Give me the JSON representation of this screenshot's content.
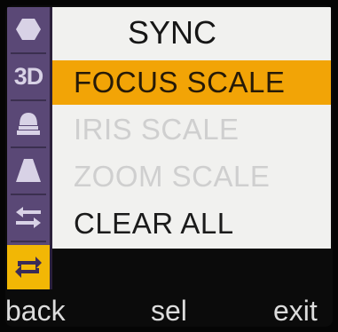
{
  "menu": {
    "title": "SYNC",
    "items": [
      {
        "label": "FOCUS SCALE",
        "state": "selected"
      },
      {
        "label": "IRIS SCALE",
        "state": "disabled"
      },
      {
        "label": "ZOOM SCALE",
        "state": "disabled"
      },
      {
        "label": "CLEAR ALL",
        "state": "normal"
      }
    ]
  },
  "rail": {
    "items": [
      {
        "icon": "hexagon-icon",
        "text": ""
      },
      {
        "icon": "3d-icon",
        "text": "3D"
      },
      {
        "icon": "lens-icon",
        "text": ""
      },
      {
        "icon": "trapezoid-icon",
        "text": ""
      },
      {
        "icon": "arrows-swap-icon",
        "text": ""
      },
      {
        "icon": "sync-icon",
        "text": "",
        "active": true
      }
    ]
  },
  "softkeys": {
    "back": "back",
    "sel": "sel",
    "exit": "exit"
  },
  "colors": {
    "rail": "#5a4876",
    "selection": "#f2a406",
    "active_icon_bg": "#f2b705",
    "panel": "#f1f1ef",
    "disabled_text": "#cfcfcf"
  }
}
